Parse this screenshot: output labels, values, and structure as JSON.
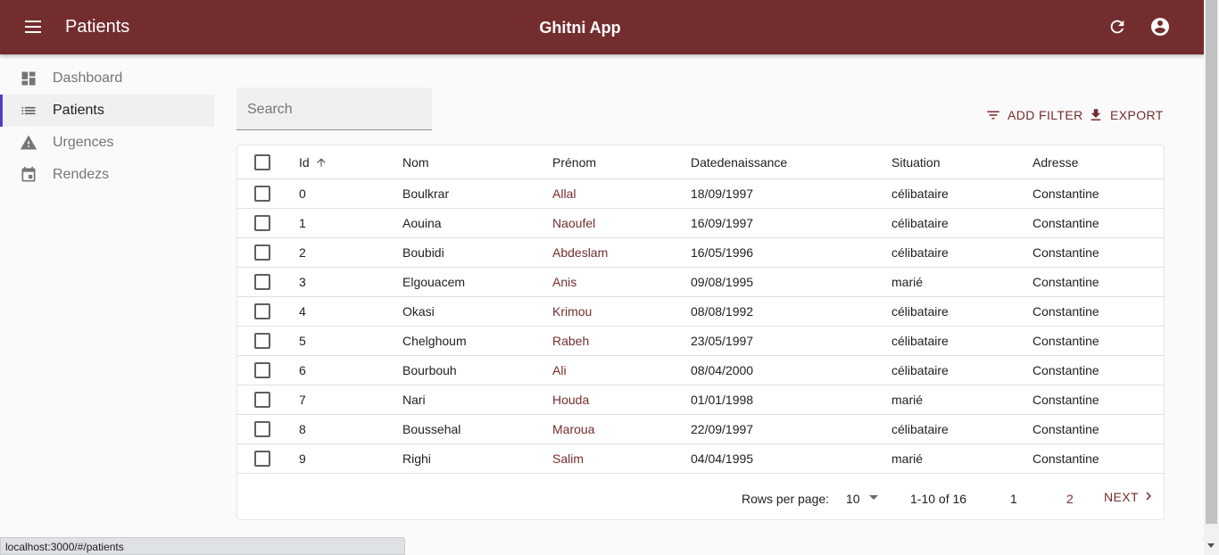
{
  "appbar": {
    "page_title": "Patients",
    "app_name": "Ghitni App"
  },
  "sidebar": {
    "items": [
      {
        "label": "Dashboard",
        "icon": "dashboard-icon"
      },
      {
        "label": "Patients",
        "icon": "list-icon",
        "active": true
      },
      {
        "label": "Urgences",
        "icon": "warning-icon"
      },
      {
        "label": "Rendezs",
        "icon": "calendar-icon"
      }
    ]
  },
  "search": {
    "placeholder": "Search"
  },
  "toolbar": {
    "add_filter": "ADD FILTER",
    "export": "EXPORT"
  },
  "table": {
    "columns": [
      "Id",
      "Nom",
      "Prénom",
      "Datedenaissance",
      "Situation",
      "Adresse"
    ],
    "rows": [
      [
        "0",
        "Boulkrar",
        "Allal",
        "18/09/1997",
        "célibataire",
        "Constantine"
      ],
      [
        "1",
        "Aouina",
        "Naoufel",
        "16/09/1997",
        "célibataire",
        "Constantine"
      ],
      [
        "2",
        "Boubidi",
        "Abdeslam",
        "16/05/1996",
        "célibataire",
        "Constantine"
      ],
      [
        "3",
        "Elgouacem",
        "Anis",
        "09/08/1995",
        "marié",
        "Constantine"
      ],
      [
        "4",
        "Okasi",
        "Krimou",
        "08/08/1992",
        "célibataire",
        "Constantine"
      ],
      [
        "5",
        "Chelghoum",
        "Rabeh",
        "23/05/1997",
        "célibataire",
        "Constantine"
      ],
      [
        "6",
        "Bourbouh",
        "Ali",
        "08/04/2000",
        "célibataire",
        "Constantine"
      ],
      [
        "7",
        "Nari",
        "Houda",
        "01/01/1998",
        "marié",
        "Constantine"
      ],
      [
        "8",
        "Boussehal",
        "Maroua",
        "22/09/1997",
        "célibataire",
        "Constantine"
      ],
      [
        "9",
        "Righi",
        "Salim",
        "04/04/1995",
        "marié",
        "Constantine"
      ]
    ]
  },
  "pagination": {
    "rows_per_page_label": "Rows per page:",
    "rows_per_page": "10",
    "range": "1-10 of 16",
    "page1": "1",
    "page2": "2",
    "next": "NEXT"
  },
  "statusbar": {
    "url": "localhost:3000/#/patients"
  },
  "colors": {
    "appbar": "#742d2f",
    "accent": "#742d2f",
    "active_border": "#4f3cc9"
  }
}
